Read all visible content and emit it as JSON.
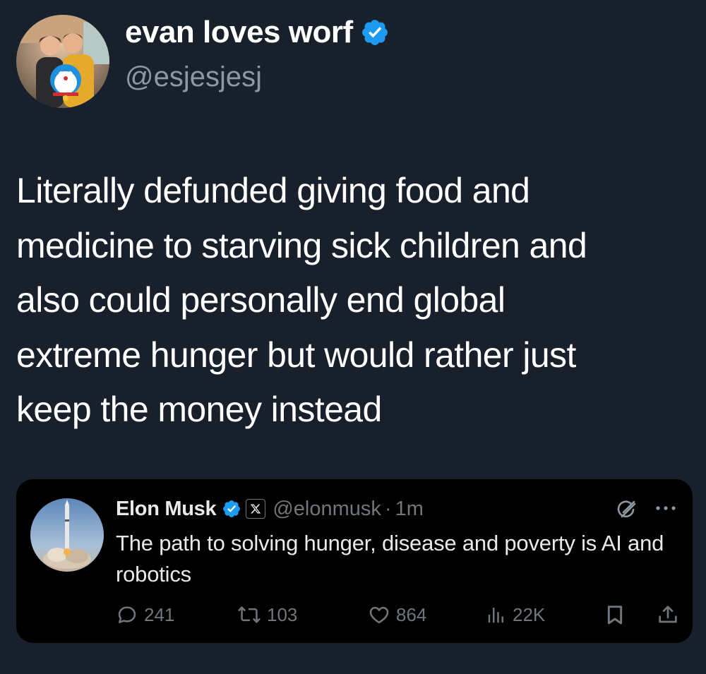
{
  "author": {
    "display_name": "evan loves worf",
    "handle": "@esjesjesj",
    "verified": true
  },
  "tweet": {
    "text": "Literally defunded giving food and\nmedicine to starving sick children and\nalso could personally end global\nextreme hunger but would rather just\nkeep the money instead"
  },
  "quoted": {
    "display_name": "Elon Musk",
    "verified": true,
    "affiliate_badge": "X",
    "handle": "@elonmusk",
    "separator": "·",
    "time": "1m",
    "text": "The path to solving hunger, disease and poverty is AI and robotics",
    "icons": [
      "grok-icon",
      "more-icon"
    ],
    "actions": {
      "replies": "241",
      "reposts": "103",
      "likes": "864",
      "views": "22K"
    }
  },
  "colors": {
    "background": "#17202b",
    "card_background": "#000000",
    "verified_blue": "#1d9bf0",
    "secondary_text": "#8b98a5",
    "muted_text": "#71767b"
  }
}
